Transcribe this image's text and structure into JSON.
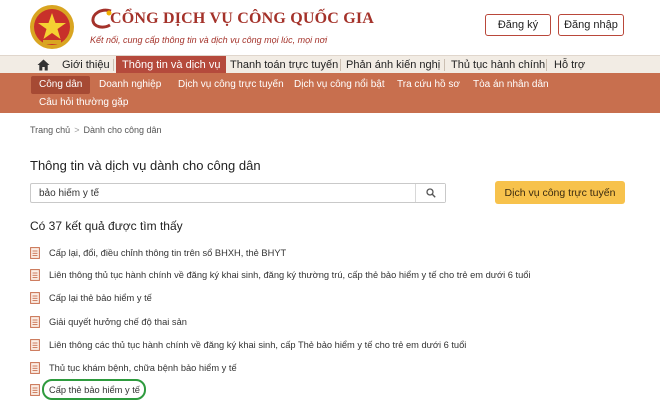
{
  "header": {
    "title": "CỔNG DỊCH VỤ CÔNG QUỐC GIA",
    "tagline": "Kết nối, cung cấp thông tin và dịch vụ công mọi lúc, mọi nơi",
    "register_label": "Đăng ký",
    "login_label": "Đăng nhập"
  },
  "main_nav": {
    "items": [
      "Giới thiệu",
      "Thông tin và dịch vụ",
      "Thanh toán trực tuyến",
      "Phản ánh kiến nghị",
      "Thủ tục hành chính",
      "Hỗ trợ"
    ]
  },
  "sub_nav": {
    "items": [
      "Công dân",
      "Doanh nghiệp",
      "Dịch vụ công trực tuyến",
      "Dịch vụ công nổi bật",
      "Tra cứu hồ sơ",
      "Tòa án nhân dân",
      "Câu hỏi thường gặp"
    ]
  },
  "breadcrumb": {
    "home": "Trang chủ",
    "current": "Dành cho công dân",
    "separator": ">"
  },
  "section_title": "Thông tin và dịch vụ dành cho công dân",
  "search": {
    "value": "bảo hiểm y tế"
  },
  "service_button": "Dịch vụ công trực tuyến",
  "result_count": "Có 37 kết quả được tìm thấy",
  "results": [
    "Cấp lại, đổi, điều chỉnh thông tin trên sổ BHXH, thẻ BHYT",
    "Liên thông thủ tục hành chính về đăng ký khai sinh, đăng ký thường trú, cấp thẻ bảo hiểm y tế cho trẻ em dưới 6 tuổi",
    "Cấp lại thẻ bảo hiểm y tế",
    "Giải quyết hưởng chế độ thai sản",
    "Liên thông các thủ tục hành chính về đăng ký khai sinh, cấp Thẻ bảo hiểm y tế cho trẻ em dưới 6 tuổi",
    "Thủ tục khám bệnh, chữa bệnh bảo hiểm y tế",
    "Cấp thẻ bảo hiểm y tế"
  ],
  "colors": {
    "brand": "#a4322a",
    "subnav_bg": "#c86f4e",
    "accent_button": "#f7c24c",
    "highlight": "#2e9b3e"
  },
  "icons": {
    "emblem": "national-emblem-icon",
    "home": "home-icon",
    "search": "search-icon",
    "result": "document-icon"
  }
}
